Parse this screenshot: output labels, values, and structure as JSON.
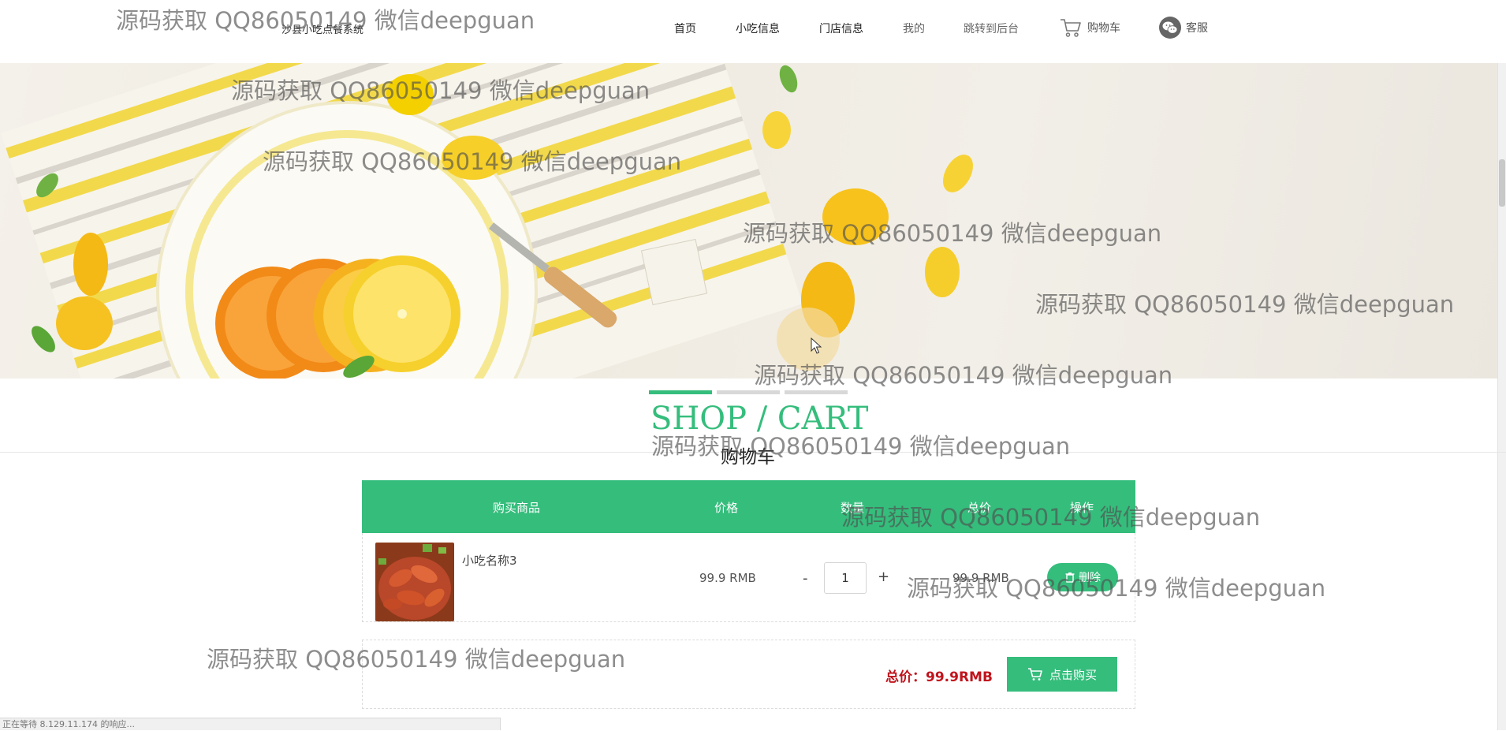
{
  "header": {
    "site_name": "沙县小吃点餐系统",
    "nav": {
      "home": "首页",
      "snack_info": "小吃信息",
      "store_info": "门店信息",
      "mine": "我的",
      "admin": "跳转到后台",
      "cart": "购物车",
      "service": "客服"
    }
  },
  "banner": {
    "slides": 3,
    "active_slide": 1
  },
  "section": {
    "title_en": "SHOP / CART",
    "title_cn": "购物车"
  },
  "cart": {
    "columns": [
      "购买商品",
      "价格",
      "数量",
      "总价",
      "操作"
    ],
    "items": [
      {
        "name": "小吃名称3",
        "price": "99.9 RMB",
        "quantity": "1",
        "total": "99.9 RMB",
        "action": "删除"
      }
    ],
    "qty_minus": "-",
    "qty_plus": "+",
    "total_label": "总价：99.9RMB",
    "buy_label": "点击购买"
  },
  "status_bar": "正在等待 8.129.11.174 的响应...",
  "watermark_text": "源码获取 QQ86050149 微信deepguan",
  "colors": {
    "accent": "#35bd7c",
    "total": "#c0141c"
  }
}
